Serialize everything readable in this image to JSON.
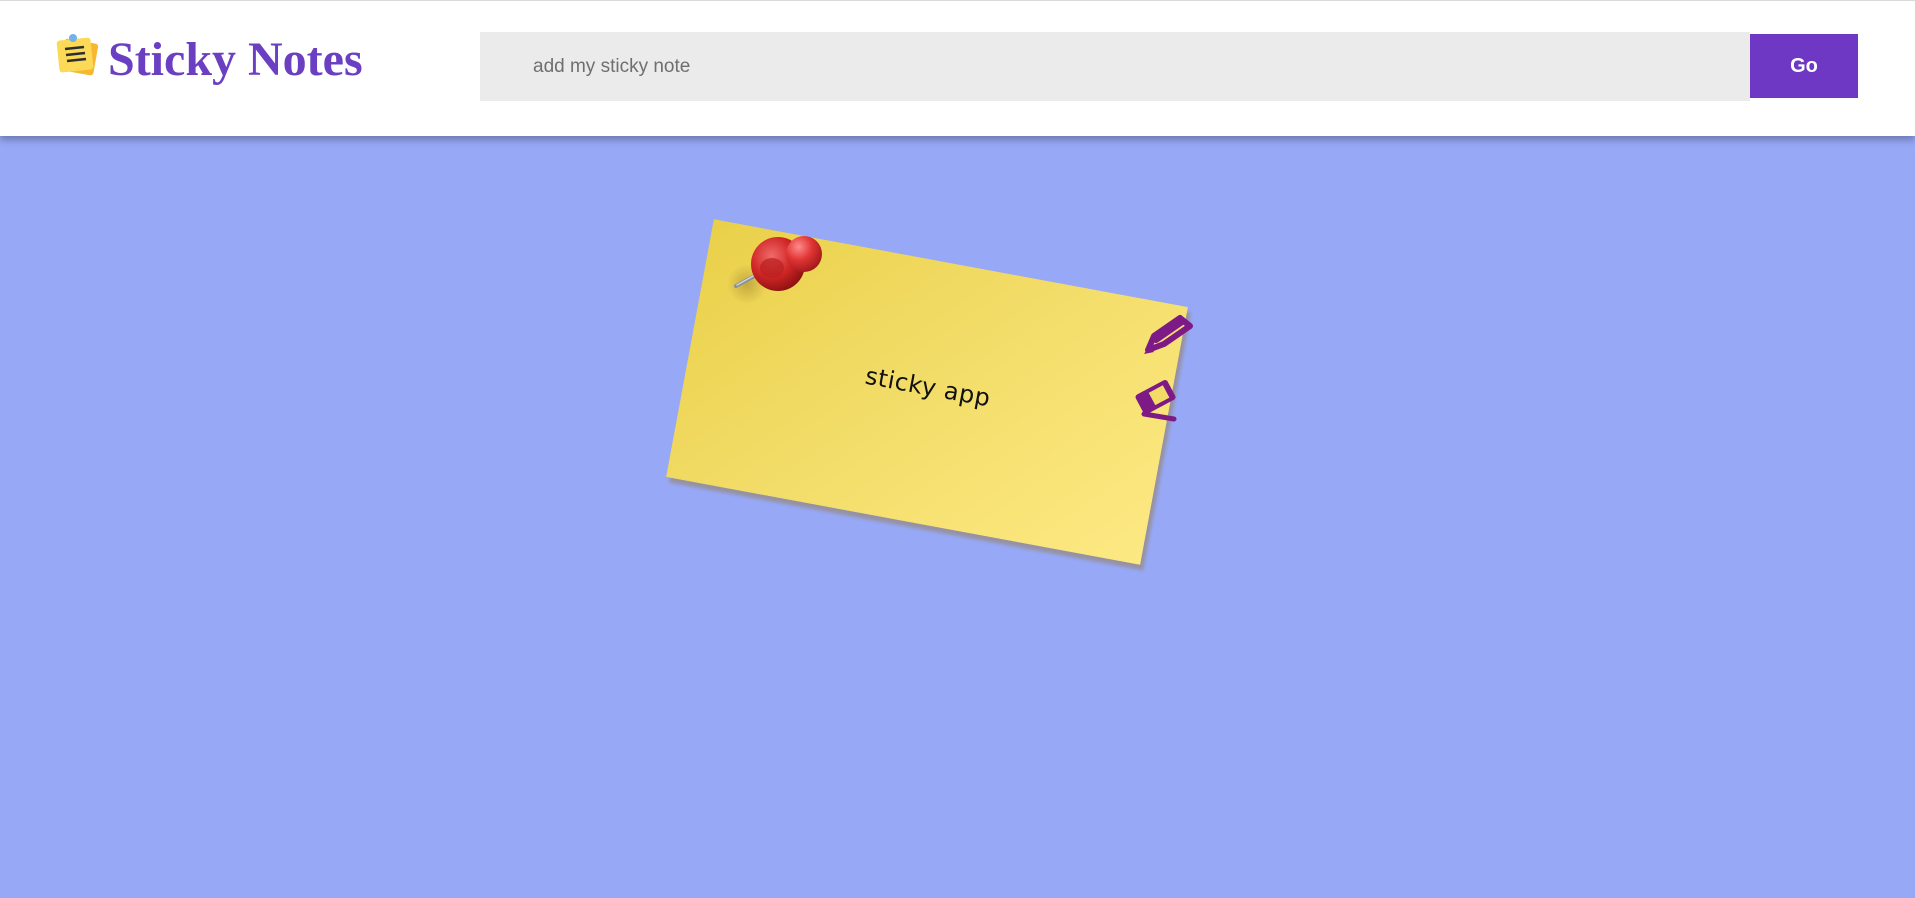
{
  "header": {
    "brand_title": "Sticky Notes",
    "logo_icon": "sticky-note-icon"
  },
  "search": {
    "placeholder": "add my sticky note",
    "value": "",
    "submit_label": "Go"
  },
  "notes": [
    {
      "text": "sticky app",
      "color": "#f2dc67",
      "pin_icon": "pushpin-icon",
      "actions": [
        {
          "name": "edit",
          "icon": "pencil-icon"
        },
        {
          "name": "delete",
          "icon": "eraser-icon"
        }
      ]
    }
  ],
  "colors": {
    "background": "#97a8f6",
    "accent": "#6e38c4",
    "action_icons": "#7e1a86",
    "pin": "#c41d1d"
  }
}
